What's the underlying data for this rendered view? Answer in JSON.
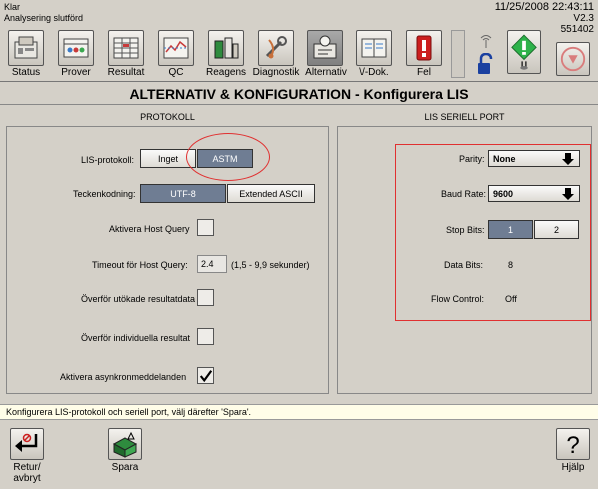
{
  "status": {
    "state": "Klar",
    "activity": "Analysering slutförd",
    "datetime": "11/25/2008  22:43:11",
    "version": "V2.3",
    "serial": "551402"
  },
  "toolbar": {
    "items": [
      {
        "label": "Status",
        "icon": "status-icon"
      },
      {
        "label": "Prover",
        "icon": "samples-icon"
      },
      {
        "label": "Resultat",
        "icon": "results-icon"
      },
      {
        "label": "QC",
        "icon": "qc-icon"
      },
      {
        "label": "Reagens",
        "icon": "reagents-icon"
      },
      {
        "label": "Diagnostik",
        "icon": "diagnostics-icon"
      },
      {
        "label": "Alternativ",
        "icon": "options-icon",
        "active": true
      },
      {
        "label": "\\/-Dok.",
        "icon": "document-icon"
      },
      {
        "label": "Fel",
        "icon": "error-icon"
      }
    ],
    "error_color": "#cc1f1f",
    "flag_color": "#2db24a",
    "stop_color": "#d97c7c"
  },
  "page_title": "ALTERNATIV & KONFIGURATION - Konfigurera LIS",
  "protocol": {
    "section_title": "PROTOKOLL",
    "lis_protocol_label": "LIS-protokoll:",
    "lis_options": [
      "Inget",
      "ASTM"
    ],
    "lis_selected": "ASTM",
    "encoding_label": "Teckenkodning:",
    "encoding_options": [
      "UTF-8",
      "Extended ASCII"
    ],
    "encoding_selected": "UTF-8",
    "host_query_label": "Aktivera Host Query",
    "host_query_checked": false,
    "timeout_label": "Timeout för Host Query:",
    "timeout_value": "2.4",
    "timeout_range": "(1,5 - 9,9 sekunder)",
    "extended_label": "Överför utökade resultatdata",
    "extended_checked": false,
    "individual_label": "Överför individuella resultat",
    "individual_checked": false,
    "async_label": "Aktivera asynkronmeddelanden",
    "async_checked": true,
    "highlight_color": "#e03030"
  },
  "serial_port": {
    "section_title": "LIS SERIELL PORT",
    "parity_label": "Parity:",
    "parity_value": "None",
    "baud_label": "Baud Rate:",
    "baud_value": "9600",
    "stop_bits_label": "Stop Bits:",
    "stop_bits_options": [
      "1",
      "2"
    ],
    "stop_bits_selected": "1",
    "data_bits_label": "Data Bits:",
    "data_bits_value": "8",
    "flow_label": "Flow Control:",
    "flow_value": "Off"
  },
  "hint": "Konfigurera LIS-protokoll och seriell port, välj därefter 'Spara'.",
  "bottom": {
    "return_label_line1": "Retur/",
    "return_label_line2": "avbryt",
    "save_label": "Spara",
    "help_label": "Hjälp"
  }
}
